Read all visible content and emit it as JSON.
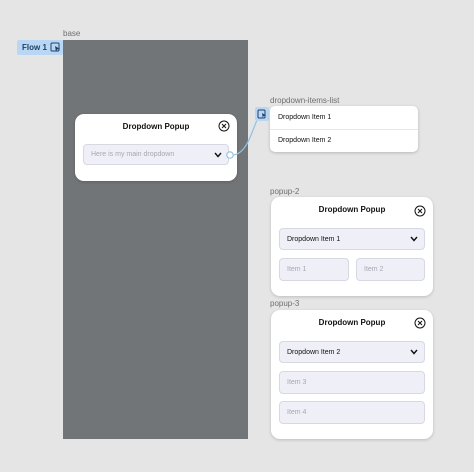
{
  "flow": {
    "label": "Flow 1"
  },
  "frames": {
    "base": "base",
    "dropdown_items_list": "dropdown-items-list",
    "popup_2": "popup-2",
    "popup_3": "popup-3"
  },
  "main_popup": {
    "title": "Dropdown Popup",
    "dropdown_placeholder": "Here is my main dropdown"
  },
  "items_list": {
    "items": [
      "Dropdown Item 1",
      "Dropdown Item 2"
    ]
  },
  "popup_2": {
    "title": "Dropdown Popup",
    "dropdown_value": "Dropdown Item 1",
    "fields": [
      "Item 1",
      "Item 2"
    ]
  },
  "popup_3": {
    "title": "Dropdown Popup",
    "dropdown_value": "Dropdown Item 2",
    "fields": [
      "Item 3",
      "Item 4"
    ]
  },
  "colors": {
    "canvas": "#e5e5e5",
    "base_frame": "#727578",
    "flow_badge": "#b9d7f4",
    "connector": "#8fc3e0",
    "field_bg": "#efeff8"
  },
  "icons": [
    "play-flow-icon",
    "close-icon",
    "chevron-down-icon",
    "link-icon"
  ]
}
